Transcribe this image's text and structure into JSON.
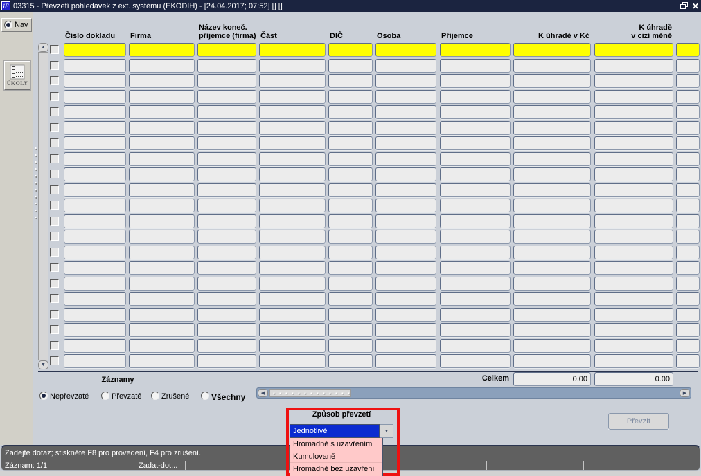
{
  "titlebar": {
    "title": "03315 - Převzetí pohledávek z ext. systému (EKODIH) - [24.04.2017; 07:52]  [] []",
    "icon_text": "iF",
    "close_glyph": "✕"
  },
  "sidebar": {
    "nav_label": "Nav",
    "ukoly_label": "ÚKOLY"
  },
  "grid": {
    "columns": [
      {
        "label": "Číslo dokladu"
      },
      {
        "label": "Firma"
      },
      {
        "label": "Název koneč.",
        "label2": "příjemce (firma)"
      },
      {
        "label": "Část"
      },
      {
        "label": "DIČ"
      },
      {
        "label": "Osoba"
      },
      {
        "label": "Příjemce"
      },
      {
        "label": "K úhradě v Kč"
      },
      {
        "label": "K úhradě",
        "label2": "v cizí měně"
      },
      {
        "label": ""
      }
    ],
    "row_count": 21,
    "totals_label": "Celkem",
    "totals": [
      "0.00",
      "0.00"
    ]
  },
  "filters": {
    "title": "Záznamy",
    "options": [
      {
        "label": "Nepřevzaté",
        "selected": true,
        "bold": false
      },
      {
        "label": "Převzaté",
        "selected": false,
        "bold": false
      },
      {
        "label": "Zrušené",
        "selected": false,
        "bold": false
      },
      {
        "label": "Všechny",
        "selected": false,
        "bold": true
      }
    ]
  },
  "transfer": {
    "label": "Způsob převzetí",
    "selected": "Jednotlivě",
    "options": [
      "Hromadně s uzavřením",
      "Kumulovaně",
      "Hromadně bez uzavření"
    ],
    "button_label": "Převzít"
  },
  "statusbar": {
    "message": "Zadejte dotaz; stiskněte F8 pro provedení, F4 pro zrušení.",
    "record": "Záznam: 1/1",
    "mode": "Zadat-dot..."
  },
  "colors": {
    "titlebar": "#1b2440",
    "canvas": "#cbd0d8",
    "current_row": "#ffff00",
    "selection_blue": "#0b2bd0",
    "list_pink": "#ffc9c9",
    "annotation_red": "#ee1111",
    "status_gray": "#606060"
  }
}
